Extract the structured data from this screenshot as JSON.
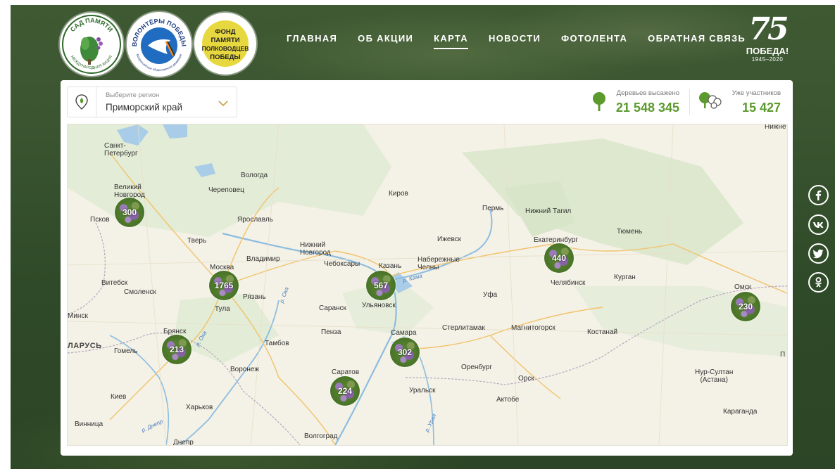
{
  "header": {
    "logos": [
      {
        "name": "sad-pamyati-logo",
        "top_text": "САД ПАМЯТИ",
        "bottom_text": "МЕЖДУНАРОДНАЯ АКЦИЯ"
      },
      {
        "name": "volontery-pobedy-logo",
        "top_text": "ВОЛОНТЁРЫ ПОБЕДЫ",
        "bottom_text": "Всероссийское общественное движение"
      },
      {
        "name": "fond-pamyati-logo",
        "lines": [
          "ФОНД",
          "ПАМЯТИ",
          "ПОЛКОВОДЦЕВ",
          "ПОБЕДЫ"
        ]
      }
    ],
    "nav": [
      {
        "label": "ГЛАВНАЯ",
        "active": false
      },
      {
        "label": "ОБ АКЦИИ",
        "active": false
      },
      {
        "label": "КАРТА",
        "active": true
      },
      {
        "label": "НОВОСТИ",
        "active": false
      },
      {
        "label": "ФОТОЛЕНТА",
        "active": false
      },
      {
        "label": "ОБРАТНАЯ СВЯЗЬ",
        "active": false
      }
    ],
    "anniversary": {
      "number": "75",
      "word": "ПОБЕДА!",
      "years": "1945–2020"
    }
  },
  "region_select": {
    "label": "Выберите регион",
    "value": "Приморский край"
  },
  "stats": {
    "trees": {
      "label": "Деревьев высажено",
      "value": "21 548 345"
    },
    "participants": {
      "label": "Уже участников",
      "value": "15 427"
    }
  },
  "map": {
    "cities": [
      {
        "name": "Санкт-\nПетербург"
      },
      {
        "name": "Вологда"
      },
      {
        "name": "Великий\nНовгород"
      },
      {
        "name": "Череповец"
      },
      {
        "name": "Киров"
      },
      {
        "name": "Псков"
      },
      {
        "name": "Ярославль"
      },
      {
        "name": "Пермь"
      },
      {
        "name": "Нижний Тагил"
      },
      {
        "name": "Тверь"
      },
      {
        "name": "Нижний\nНовгород"
      },
      {
        "name": "Ижевск"
      },
      {
        "name": "Тюмень"
      },
      {
        "name": "Екатеринбург"
      },
      {
        "name": "Владимир"
      },
      {
        "name": "Чебоксары"
      },
      {
        "name": "Казань"
      },
      {
        "name": "Набережные\nЧелны"
      },
      {
        "name": "Москва"
      },
      {
        "name": "Витебск"
      },
      {
        "name": "Смоленск"
      },
      {
        "name": "Рязань"
      },
      {
        "name": "Челябинск"
      },
      {
        "name": "Курган"
      },
      {
        "name": "Омск"
      },
      {
        "name": "Тула"
      },
      {
        "name": "Саранск"
      },
      {
        "name": "Ульяновск"
      },
      {
        "name": "Уфа"
      },
      {
        "name": "Минск"
      },
      {
        "name": "Брянск"
      },
      {
        "name": "Пенза"
      },
      {
        "name": "Самара"
      },
      {
        "name": "Стерлитамак"
      },
      {
        "name": "Магнитогорск"
      },
      {
        "name": "Костанай"
      },
      {
        "name": "Гомель"
      },
      {
        "name": "Тамбов"
      },
      {
        "name": "Воронеж"
      },
      {
        "name": "Саратов"
      },
      {
        "name": "Оренбург"
      },
      {
        "name": "Орск"
      },
      {
        "name": "Нур-Султан\n(Астана)"
      },
      {
        "name": "Киев"
      },
      {
        "name": "Уральск"
      },
      {
        "name": "Актобе"
      },
      {
        "name": "Харьков"
      },
      {
        "name": "Караганда"
      },
      {
        "name": "Винница"
      },
      {
        "name": "Волгоград"
      },
      {
        "name": "Днепр"
      },
      {
        "name": "Нижне"
      },
      {
        "name": "П"
      }
    ],
    "country_label": "ЛАРУСЬ",
    "rivers": [
      {
        "name": "р. Ока"
      },
      {
        "name": "р. Ока"
      },
      {
        "name": "р. Кама"
      },
      {
        "name": "р. Днепр"
      },
      {
        "name": "р. Урал"
      }
    ],
    "clusters": [
      {
        "count": "300"
      },
      {
        "count": "1765"
      },
      {
        "count": "567"
      },
      {
        "count": "440"
      },
      {
        "count": "230"
      },
      {
        "count": "213"
      },
      {
        "count": "302"
      },
      {
        "count": "224"
      }
    ]
  },
  "social": [
    {
      "icon": "facebook-icon"
    },
    {
      "icon": "vk-icon"
    },
    {
      "icon": "twitter-icon"
    },
    {
      "icon": "odnoklassniki-icon"
    }
  ]
}
